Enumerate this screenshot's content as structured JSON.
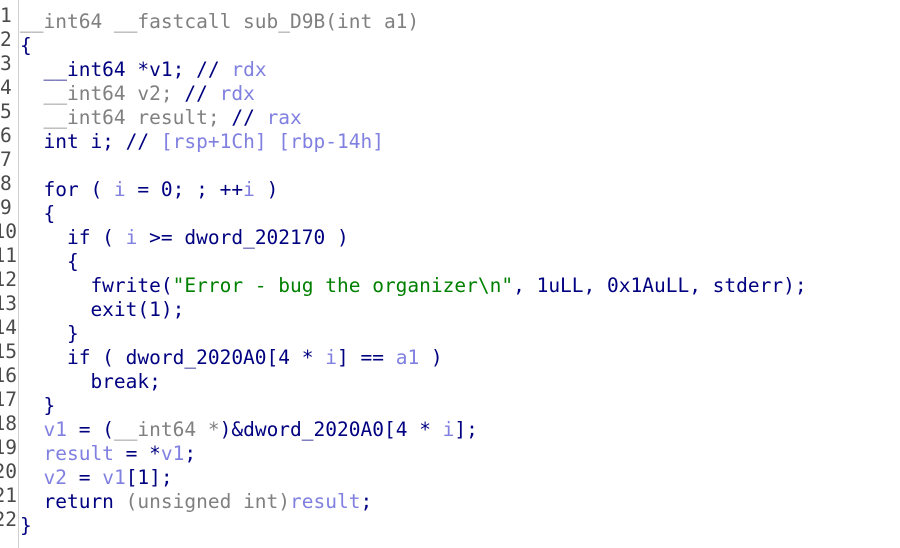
{
  "lines": [
    {
      "num": "1",
      "tokens": [
        {
          "t": "__int64 __fastcall sub_D9B(int a1)",
          "c": "t-gray"
        }
      ]
    },
    {
      "num": "2",
      "tokens": [
        {
          "t": "{",
          "c": "t-kw"
        }
      ]
    },
    {
      "num": "3",
      "tokens": [
        {
          "t": "  __int64 *v1; ",
          "c": "t-kw"
        },
        {
          "t": "// ",
          "c": "t-kw"
        },
        {
          "t": "rdx",
          "c": "t-var"
        }
      ]
    },
    {
      "num": "4",
      "tokens": [
        {
          "t": "  __int64 v2; ",
          "c": "t-gray"
        },
        {
          "t": "// ",
          "c": "t-kw"
        },
        {
          "t": "rdx",
          "c": "t-var"
        }
      ]
    },
    {
      "num": "5",
      "tokens": [
        {
          "t": "  __int64 result; ",
          "c": "t-gray"
        },
        {
          "t": "// ",
          "c": "t-kw"
        },
        {
          "t": "rax",
          "c": "t-var"
        }
      ]
    },
    {
      "num": "6",
      "tokens": [
        {
          "t": "  int i; ",
          "c": "t-kw"
        },
        {
          "t": "// ",
          "c": "t-kw"
        },
        {
          "t": "[rsp+1Ch] [rbp-14h]",
          "c": "t-var"
        }
      ]
    },
    {
      "num": "7",
      "tokens": []
    },
    {
      "num": "8",
      "tokens": [
        {
          "t": "  for ( ",
          "c": "t-kw"
        },
        {
          "t": "i",
          "c": "t-var"
        },
        {
          "t": " = 0; ; ++",
          "c": "t-kw"
        },
        {
          "t": "i",
          "c": "t-var"
        },
        {
          "t": " )",
          "c": "t-kw"
        }
      ]
    },
    {
      "num": "9",
      "tokens": [
        {
          "t": "  {",
          "c": "t-kw"
        }
      ]
    },
    {
      "num": "10",
      "tokens": [
        {
          "t": "    if ( ",
          "c": "t-kw"
        },
        {
          "t": "i",
          "c": "t-var"
        },
        {
          "t": " >= dword_202170 )",
          "c": "t-kw"
        }
      ]
    },
    {
      "num": "11",
      "tokens": [
        {
          "t": "    {",
          "c": "t-kw"
        }
      ]
    },
    {
      "num": "12",
      "tokens": [
        {
          "t": "      fwrite(",
          "c": "t-kw"
        },
        {
          "t": "\"Error - bug the organizer\\n\"",
          "c": "t-str"
        },
        {
          "t": ", 1uLL, 0x1AuLL, stderr);",
          "c": "t-kw"
        }
      ]
    },
    {
      "num": "13",
      "tokens": [
        {
          "t": "      exit(1);",
          "c": "t-kw"
        }
      ]
    },
    {
      "num": "14",
      "tokens": [
        {
          "t": "    }",
          "c": "t-kw"
        }
      ]
    },
    {
      "num": "15",
      "tokens": [
        {
          "t": "    if ( dword_2020A0[4 * ",
          "c": "t-kw"
        },
        {
          "t": "i",
          "c": "t-var"
        },
        {
          "t": "] == ",
          "c": "t-kw"
        },
        {
          "t": "a1",
          "c": "t-var"
        },
        {
          "t": " )",
          "c": "t-kw"
        }
      ]
    },
    {
      "num": "16",
      "tokens": [
        {
          "t": "      break;",
          "c": "t-kw"
        }
      ]
    },
    {
      "num": "17",
      "tokens": [
        {
          "t": "  }",
          "c": "t-kw"
        }
      ]
    },
    {
      "num": "18",
      "tokens": [
        {
          "t": "  ",
          "c": "t-kw"
        },
        {
          "t": "v1",
          "c": "t-var"
        },
        {
          "t": " = (",
          "c": "t-kw"
        },
        {
          "t": "__int64 *",
          "c": "t-gray"
        },
        {
          "t": ")&dword_2020A0[4 * ",
          "c": "t-kw"
        },
        {
          "t": "i",
          "c": "t-var"
        },
        {
          "t": "];",
          "c": "t-kw"
        }
      ]
    },
    {
      "num": "19",
      "tokens": [
        {
          "t": "  ",
          "c": "t-kw"
        },
        {
          "t": "result",
          "c": "t-var"
        },
        {
          "t": " = *",
          "c": "t-kw"
        },
        {
          "t": "v1",
          "c": "t-var"
        },
        {
          "t": ";",
          "c": "t-kw"
        }
      ]
    },
    {
      "num": "20",
      "tokens": [
        {
          "t": "  ",
          "c": "t-kw"
        },
        {
          "t": "v2",
          "c": "t-var"
        },
        {
          "t": " = ",
          "c": "t-kw"
        },
        {
          "t": "v1",
          "c": "t-var"
        },
        {
          "t": "[1];",
          "c": "t-kw"
        }
      ]
    },
    {
      "num": "21",
      "tokens": [
        {
          "t": "  return ",
          "c": "t-kw"
        },
        {
          "t": "(unsigned int)",
          "c": "t-gray"
        },
        {
          "t": "result",
          "c": "t-var"
        },
        {
          "t": ";",
          "c": "t-kw"
        }
      ]
    },
    {
      "num": "22",
      "tokens": [
        {
          "t": "}",
          "c": "t-kw"
        }
      ]
    }
  ]
}
